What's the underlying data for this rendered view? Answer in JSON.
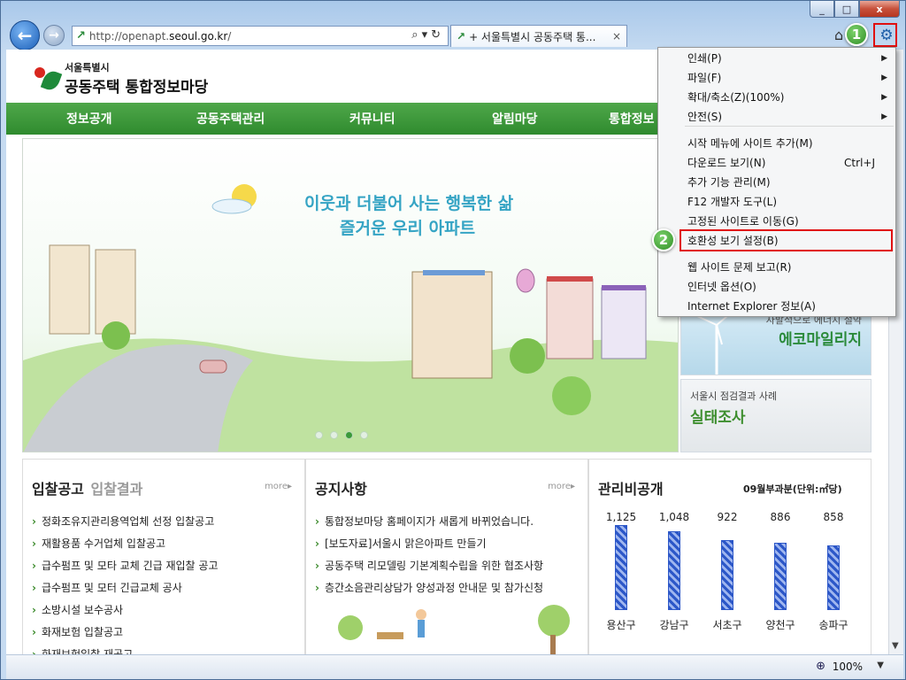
{
  "window": {
    "minimize": "_",
    "maximize": "□",
    "close": "x"
  },
  "browser": {
    "back_icon": "←",
    "forward_icon": "→",
    "address": {
      "prefix": "http://openapt.",
      "domain": "seoul.go.kr",
      "suffix": "/",
      "tools": "⌕▾↻"
    },
    "tab": {
      "title": "+ 서울특별시 공동주택 통...",
      "close": "×"
    },
    "home_icon": "⌂",
    "gear_icon": "⚙"
  },
  "markers": {
    "one": "1",
    "two": "2"
  },
  "site": {
    "logo_small": "서울특별시",
    "logo_large": "공동주택 통합정보마당",
    "nav": [
      "정보공개",
      "공동주택관리",
      "커뮤니티",
      "알림마당",
      "통합정보"
    ],
    "hero": {
      "line1": "이웃과 더불어 사는 행복한 삶",
      "line2": "즐거운 우리 아파트",
      "slide_count": 4,
      "active_slide": 3
    },
    "banners": {
      "eco_small": "자발적으로 에너지 절약",
      "eco_large": "에코마일리지",
      "survey_small": "서울시 점검결과 사례",
      "survey_large": "실태조사"
    }
  },
  "panels": {
    "bids": {
      "title": "입찰공고",
      "subtitle": "입찰결과",
      "more": "more▸",
      "items": [
        "정화조유지관리용역업체 선정 입찰공고",
        "재활용품 수거업체 입찰공고",
        "급수펌프 및 모타 교체 긴급 재입찰 공고",
        "급수펌프 및 모터 긴급교체 공사",
        "소방시설 보수공사",
        "화재보험 입찰공고",
        "화재보험입찰 재공고"
      ]
    },
    "notices": {
      "title": "공지사항",
      "more": "more▸",
      "items": [
        "통합정보마당 홈페이지가 새롭게 바뀌었습니다.",
        "[보도자료]서울시 맑은아파트 만들기",
        "공동주택 리모델링 기본계획수립을 위한 협조사항",
        "층간소음관리상담가 양성과정 안내문 및 참가신청"
      ]
    },
    "mgmt": {
      "title": "관리비공개",
      "unit": "09월부과분(단위:㎡당)"
    }
  },
  "chart_data": {
    "type": "bar",
    "categories": [
      "용산구",
      "강남구",
      "서초구",
      "양천구",
      "송파구"
    ],
    "value_labels": [
      "1,125",
      "1,048",
      "922",
      "886",
      "858"
    ],
    "values": [
      1125,
      1048,
      922,
      886,
      858
    ]
  },
  "status": {
    "zoom": "100%",
    "zoom_icon": "⊕",
    "dropdown": "▼"
  },
  "menu": {
    "items": [
      {
        "label": "인쇄(P)",
        "accel": "",
        "submenu": true
      },
      {
        "label": "파일(F)",
        "accel": "",
        "submenu": true
      },
      {
        "label": "확대/축소(Z)(100%)",
        "accel": "",
        "submenu": true
      },
      {
        "label": "안전(S)",
        "accel": "",
        "submenu": true
      },
      {
        "label": "시작 메뉴에 사이트 추가(M)",
        "accel": "",
        "submenu": false
      },
      {
        "label": "다운로드 보기(N)",
        "accel": "Ctrl+J",
        "submenu": false
      },
      {
        "label": "추가 기능 관리(M)",
        "accel": "",
        "submenu": false
      },
      {
        "label": "F12 개발자 도구(L)",
        "accel": "",
        "submenu": false
      },
      {
        "label": "고정된 사이트로 이동(G)",
        "accel": "",
        "submenu": false
      },
      {
        "label": "호환성 보기 설정(B)",
        "accel": "",
        "submenu": false
      },
      {
        "label": "웹 사이트 문제 보고(R)",
        "accel": "",
        "submenu": false
      },
      {
        "label": "인터넷 옵션(O)",
        "accel": "",
        "submenu": false
      },
      {
        "label": "Internet Explorer 정보(A)",
        "accel": "",
        "submenu": false
      }
    ],
    "arrow": "▶"
  }
}
